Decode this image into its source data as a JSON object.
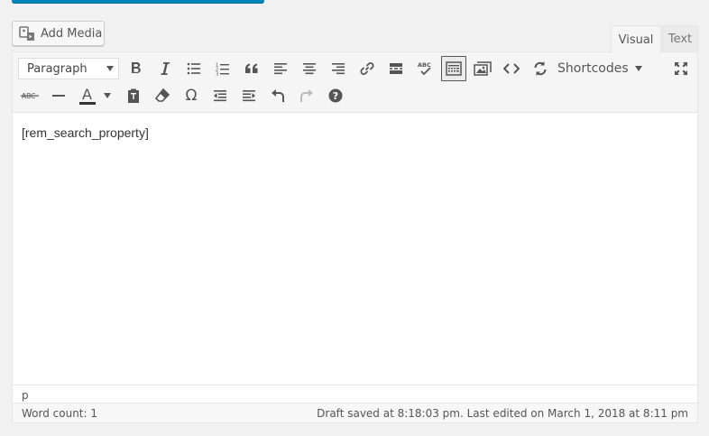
{
  "add_media": {
    "label": "Add Media",
    "icon": "media-icon"
  },
  "tabs": [
    {
      "label": "Visual",
      "active": true
    },
    {
      "label": "Text",
      "active": false
    }
  ],
  "toolbar": {
    "format_select": {
      "value": "Paragraph"
    },
    "shortcodes": {
      "label": "Shortcodes"
    },
    "row1_icons": [
      "bold-icon",
      "italic-icon",
      "bulleted-list-icon",
      "numbered-list-icon",
      "blockquote-icon",
      "align-left-icon",
      "align-center-icon",
      "align-right-icon",
      "insert-link-icon",
      "read-more-icon",
      "spellcheck-icon",
      "toolbar-toggle-icon",
      "insert-image-icon",
      "code-icon",
      "refresh-icon",
      "fullscreen-icon"
    ],
    "row2_icons": [
      "strikethrough-icon",
      "horizontal-line-icon",
      "text-color-icon",
      "paste-text-icon",
      "clear-formatting-icon",
      "special-character-icon",
      "outdent-icon",
      "indent-icon",
      "undo-icon",
      "redo-icon",
      "help-icon"
    ],
    "text_color_letter": "A"
  },
  "editor": {
    "content": "[rem_search_property]"
  },
  "path": "p",
  "status": {
    "word_count": "Word count: 1",
    "draft": "Draft saved at 8:18:03 pm. Last edited on March 1, 2018 at 8:11 pm"
  },
  "colors": {
    "accent": "#0085ba",
    "active_toolbar_border": "#555555"
  }
}
